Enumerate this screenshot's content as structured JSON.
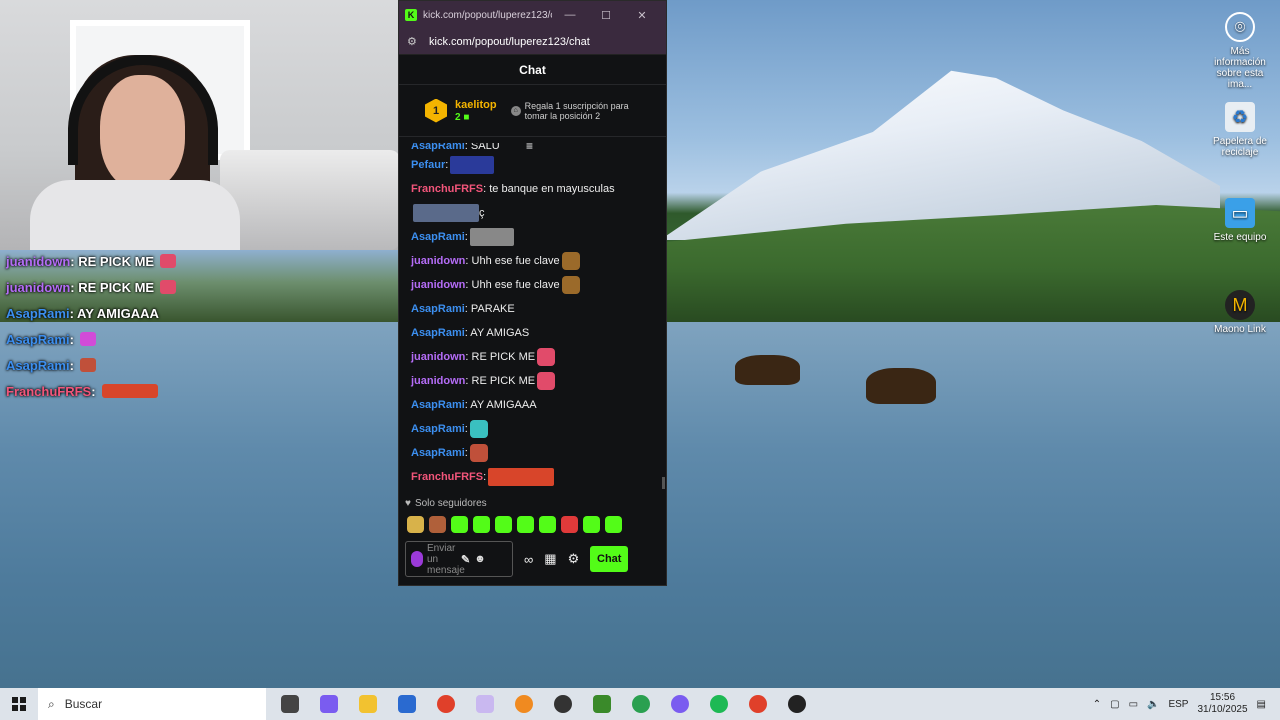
{
  "desktop": {
    "icons": [
      {
        "label": "Más información sobre esta ima...",
        "icon": "camera-info-icon"
      },
      {
        "label": "Papelera de reciclaje",
        "icon": "recycle-bin-icon"
      },
      {
        "label": "Este equipo",
        "icon": "computer-icon"
      },
      {
        "label": "Maono Link",
        "icon": "maono-icon"
      }
    ]
  },
  "overlay_chat": [
    {
      "user": "juanidown",
      "text": " : RE PICK ME",
      "color": "#b46cf6",
      "emote": "#e14b6a"
    },
    {
      "user": "juanidown",
      "text": " : RE PICK ME",
      "color": "#b46cf6",
      "emote": "#e14b6a"
    },
    {
      "user": "AsapRami",
      "text": " : AY AMIGAAA",
      "color": "#3c8ff0",
      "emote": ""
    },
    {
      "user": "AsapRami",
      "text": " : ",
      "color": "#3c8ff0",
      "emote": "#d24bd8"
    },
    {
      "user": "AsapRami",
      "text": " : ",
      "color": "#3c8ff0",
      "emote": "#c0503a"
    },
    {
      "user": "FranchuFRFS",
      "text": " : ",
      "color": "#f2557a",
      "emote": "#d8452a"
    }
  ],
  "popout": {
    "window_title": "kick.com/popout/luperez123/c...",
    "url": "kick.com/popout/luperez123/chat",
    "header": "Chat",
    "pinned": {
      "rank": "1",
      "gifter": "kaelitop",
      "gift_count": "2",
      "gift_prompt_line1": "Regala 1 suscripción para",
      "gift_prompt_line2": "tomar la posición 2"
    },
    "messages": [
      {
        "user": "AsapRami",
        "text": ": SALU",
        "color": "#3c8ff0",
        "emote": ""
      },
      {
        "user": "Pefaur",
        "text": ":",
        "color": "#3c8ff0",
        "emote": "#2a3a9a"
      },
      {
        "user": "FranchuFRFS",
        "text": ": te banque en mayusculas",
        "color": "#f2557a",
        "emote": ""
      },
      {
        "user": "",
        "text": "ç",
        "color": "#eee",
        "emote": "#5a6a8a"
      },
      {
        "user": "AsapRami",
        "text": ":",
        "color": "#3c8ff0",
        "emote": "#888"
      },
      {
        "user": "juanidown",
        "text": ": Uhh ese fue clave",
        "color": "#b46cf6",
        "emote": "#9b6a2a"
      },
      {
        "user": "juanidown",
        "text": ": Uhh ese fue clave",
        "color": "#b46cf6",
        "emote": "#9b6a2a"
      },
      {
        "user": "AsapRami",
        "text": ": PARAKE",
        "color": "#3c8ff0",
        "emote": ""
      },
      {
        "user": "AsapRami",
        "text": ": AY AMIGAS",
        "color": "#3c8ff0",
        "emote": ""
      },
      {
        "user": "juanidown",
        "text": ": RE PICK ME",
        "color": "#b46cf6",
        "emote": "#e14b6a"
      },
      {
        "user": "juanidown",
        "text": ": RE PICK ME",
        "color": "#b46cf6",
        "emote": "#e14b6a"
      },
      {
        "user": "AsapRami",
        "text": ": AY AMIGAAA",
        "color": "#3c8ff0",
        "emote": ""
      },
      {
        "user": "AsapRami",
        "text": ":",
        "color": "#3c8ff0",
        "emote": "#3ac0c0"
      },
      {
        "user": "AsapRami",
        "text": ":",
        "color": "#3c8ff0",
        "emote": "#c0503a"
      },
      {
        "user": "FranchuFRFS",
        "text": ":",
        "color": "#f2557a",
        "emote": "#d8452a"
      }
    ],
    "followers_only": "Solo seguidores",
    "input_placeholder": "Enviar un mensaje",
    "send_label": "Chat",
    "emote_bar": [
      "#d8b24a",
      "#b0603a",
      "#53fc18",
      "#53fc18",
      "#53fc18",
      "#53fc18",
      "#53fc18",
      "#e03a3a",
      "#53fc18",
      "#53fc18"
    ]
  },
  "taskbar": {
    "search_placeholder": "Buscar",
    "apps": [
      {
        "name": "task-view-icon",
        "color": "#444"
      },
      {
        "name": "copilot-icon",
        "color": "#7a5cf0"
      },
      {
        "name": "file-explorer-icon",
        "color": "#f2c230"
      },
      {
        "name": "store-icon",
        "color": "#2a6ad0"
      },
      {
        "name": "chrome-icon",
        "color": "#e0402a"
      },
      {
        "name": "word-online-icon",
        "color": "#c9b8f0"
      },
      {
        "name": "sun-app-icon",
        "color": "#f08a20"
      },
      {
        "name": "obs-icon",
        "color": "#333"
      },
      {
        "name": "minecraft-icon",
        "color": "#3a8a2a"
      },
      {
        "name": "chrome-profile-icon",
        "color": "#2aa050"
      },
      {
        "name": "discord-icon",
        "color": "#7a5cf0"
      },
      {
        "name": "spotify-icon",
        "color": "#1db954"
      },
      {
        "name": "chrome-profile2-icon",
        "color": "#e0402a"
      },
      {
        "name": "app-icon",
        "color": "#222"
      }
    ],
    "lang": "ESP",
    "time": "15:56",
    "date": "31/10/2025"
  }
}
